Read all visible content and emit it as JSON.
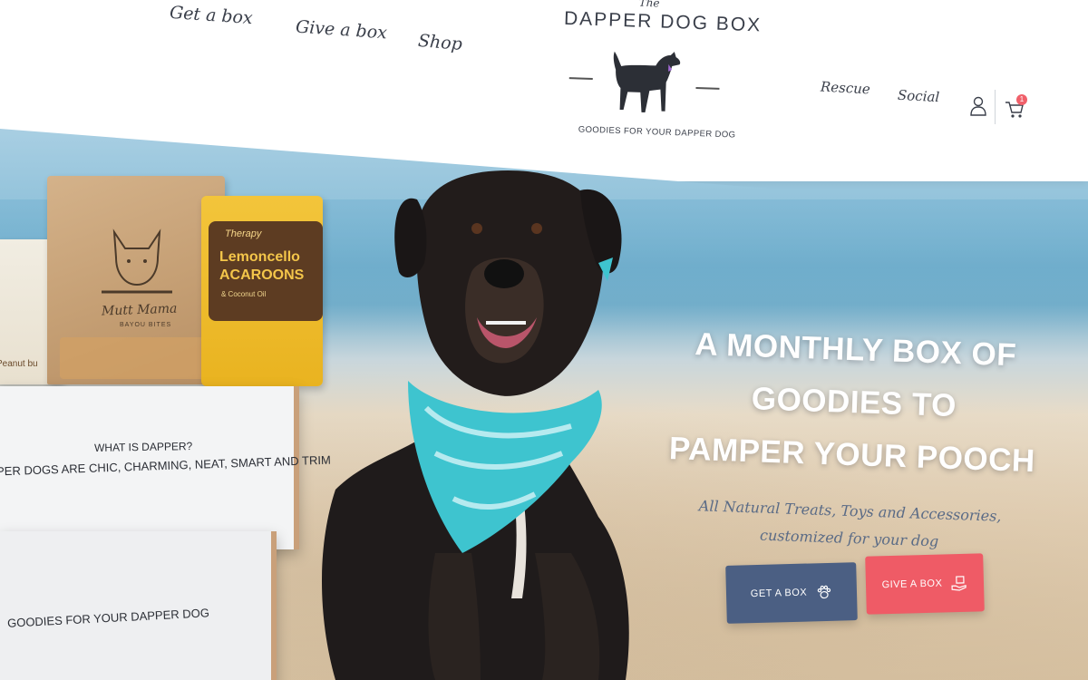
{
  "brand": {
    "the": "The",
    "title": "DAPPER DOG BOX",
    "tagline": "GOODIES FOR YOUR DAPPER DOG"
  },
  "nav": {
    "get_a_box": "Get a box",
    "give_a_box": "Give a box",
    "shop": "Shop",
    "rescue": "Rescue",
    "social": "Social"
  },
  "header_icons": {
    "user": "user-icon",
    "cart": "cart-icon",
    "cart_count": "1"
  },
  "hero": {
    "title_line1": "A MONTHLY BOX OF",
    "title_line2": "GOODIES TO",
    "title_line3": "PAMPER YOUR POOCH",
    "subtitle_line1": "All Natural Treats, Toys and Accessories,",
    "subtitle_line2": "customized for your dog",
    "cta_get": "GET A BOX",
    "cta_give": "GIVE A BOX"
  },
  "product_box": {
    "question": "WHAT IS DAPPER?",
    "definition": "PER DOGS ARE CHIC, CHARMING, NEAT, SMART AND TRIM",
    "bottom_tagline": "GOODIES FOR YOUR DAPPER DOG"
  },
  "bags": {
    "kraft_brand": "Mutt Mama",
    "kraft_sub": "BAYOU BITES",
    "yellow_brand": "Therapy",
    "yellow_name_line1": "Lemoncello",
    "yellow_name_line2": "ACAROONS",
    "yellow_sub": "& Coconut Oil",
    "tub_label": "Peanut bu"
  },
  "colors": {
    "primary_button": "#4b5f83",
    "secondary_button": "#ef5b66",
    "text_dark": "#3a3f4a",
    "subtitle": "#5a6b86",
    "cart_badge": "#f0606a",
    "bandana": "#3ec4cf"
  }
}
